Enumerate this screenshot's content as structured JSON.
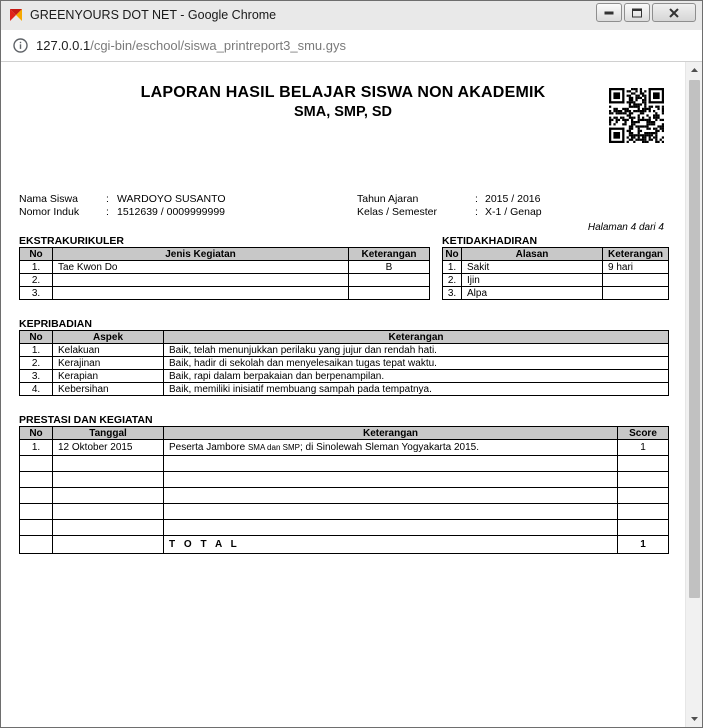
{
  "window": {
    "title": "GREENYOURS DOT NET - Google Chrome",
    "controls": [
      "minimize-icon",
      "restore-icon",
      "close-icon"
    ]
  },
  "address_bar": {
    "host": "127.0.0.1",
    "path": "/cgi-bin/eschool/siswa_printreport3_smu.gys"
  },
  "report": {
    "title_line1": "LAPORAN HASIL BELAJAR SISWA NON AKADEMIK",
    "title_line2": "SMA, SMP, SD",
    "student": {
      "name_label": "Nama Siswa",
      "name_value": "WARDOYO SUSANTO",
      "nis_label": "Nomor Induk",
      "nis_value": "1512639 / 0009999999",
      "year_label": "Tahun Ajaran",
      "year_value": "2015 / 2016",
      "class_label": "Kelas / Semester",
      "class_value": "X-1 / Genap",
      "separator": ":"
    },
    "page_note": "Halaman 4 dari 4",
    "ekstrakurikuler": {
      "heading": "EKSTRAKURIKULER",
      "headers": [
        "No",
        "Jenis Kegiatan",
        "Keterangan"
      ],
      "rows": [
        [
          "1.",
          "Tae Kwon Do",
          "B"
        ],
        [
          "2.",
          "",
          ""
        ],
        [
          "3.",
          "",
          ""
        ]
      ]
    },
    "ketidakhadiran": {
      "heading": "KETIDAKHADIRAN",
      "headers": [
        "No",
        "Alasan",
        "Keterangan"
      ],
      "rows": [
        [
          "1.",
          "Sakit",
          "9 hari"
        ],
        [
          "2.",
          "Ijin",
          ""
        ],
        [
          "3.",
          "Alpa",
          ""
        ]
      ]
    },
    "kepribadian": {
      "heading": "KEPRIBADIAN",
      "headers": [
        "No",
        "Aspek",
        "Keterangan"
      ],
      "rows": [
        [
          "1.",
          "Kelakuan",
          "Baik, telah menunjukkan perilaku yang jujur dan rendah hati."
        ],
        [
          "2.",
          "Kerajinan",
          "Baik, hadir di sekolah dan menyelesaikan tugas tepat waktu."
        ],
        [
          "3.",
          "Kerapian",
          "Baik, rapi dalam berpakaian dan berpenampilan."
        ],
        [
          "4.",
          "Kebersihan",
          "Baik, memiliki inisiatif membuang sampah pada tempatnya."
        ]
      ]
    },
    "prestasi": {
      "heading": "PRESTASI DAN KEGIATAN",
      "headers": [
        "No",
        "Tanggal",
        "Keterangan",
        "Score"
      ],
      "row1": {
        "no": "1.",
        "date": "12 Oktober 2015",
        "desc_a": "Peserta Jambore ",
        "desc_small": "SMA dan SMP",
        "desc_b": "; di Sinolewah Sleman Yogyakarta 2015.",
        "score": "1"
      },
      "empty_rows": 5,
      "total_label": "T O T A L",
      "total_value": "1"
    }
  }
}
